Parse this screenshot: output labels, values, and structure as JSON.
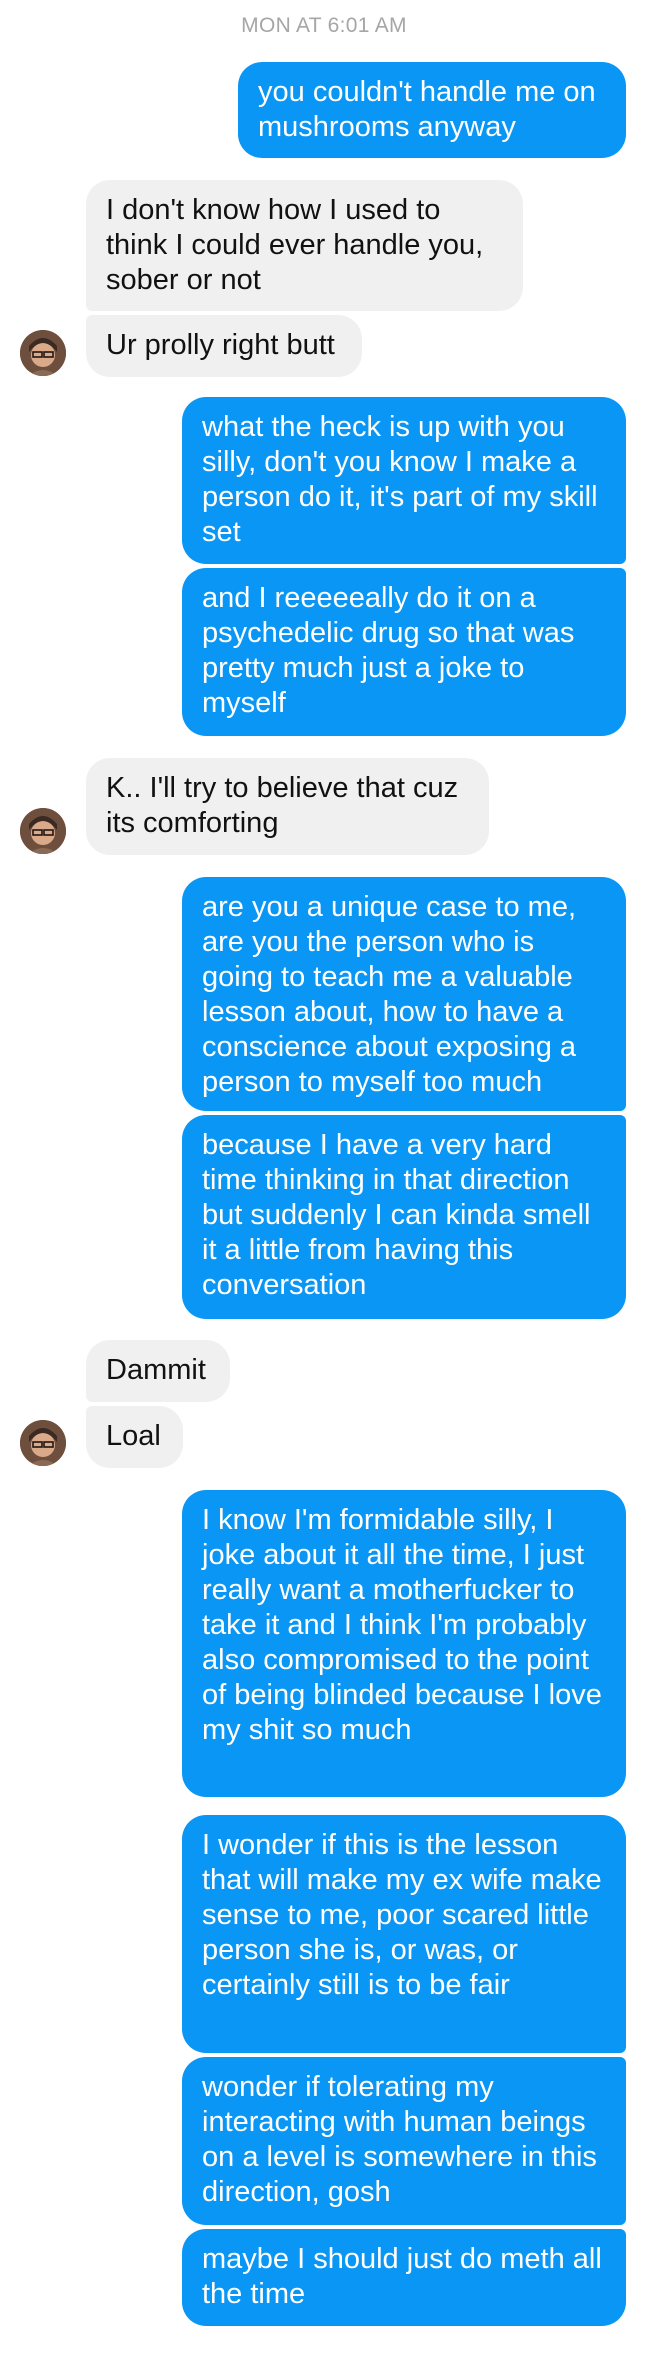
{
  "timestamp": "MON AT 6:01 AM",
  "colors": {
    "outgoing_bubble": "#0a96f4",
    "incoming_bubble": "#f1f0f0",
    "timestamp_text": "#a6a6a6"
  },
  "messages": [
    {
      "direction": "out",
      "text": "you couldn't handle me on mushrooms anyway"
    },
    {
      "direction": "in",
      "text": "I don't know how I used to think I could ever handle you, sober or not"
    },
    {
      "direction": "in",
      "text": "Ur prolly right butt"
    },
    {
      "direction": "out",
      "text": "what the heck is up with you silly, don't you know I make a person do it, it's part of my skill set"
    },
    {
      "direction": "out",
      "text": "and I reeeeeally do it on a psychedelic drug so that was pretty much just a joke to myself"
    },
    {
      "direction": "in",
      "text": "K.. I'll try to believe that cuz its comforting"
    },
    {
      "direction": "out",
      "text": "are you a unique case to me, are you the person who is going to teach me a valuable lesson about, how to have a conscience about exposing a person to myself too much"
    },
    {
      "direction": "out",
      "text": "because I have a very hard time thinking in that direction but suddenly I can kinda smell it a little from having this conversation"
    },
    {
      "direction": "in",
      "text": "Dammit"
    },
    {
      "direction": "in",
      "text": "Loal"
    },
    {
      "direction": "out",
      "text": "I know I'm formidable silly, I joke about it all the time, I just really want a motherfucker to take it and I think I'm probably also compromised to the point of being blinded because I love my shit so much"
    },
    {
      "direction": "out",
      "text": "I wonder if this is the lesson that will make my ex wife make sense to me, poor scared little person she is, or was, or certainly still is to be fair"
    },
    {
      "direction": "out",
      "text": "wonder if tolerating my interacting with human beings on a level is somewhere in this direction, gosh"
    },
    {
      "direction": "out",
      "text": "maybe I should just do meth all the time"
    }
  ]
}
